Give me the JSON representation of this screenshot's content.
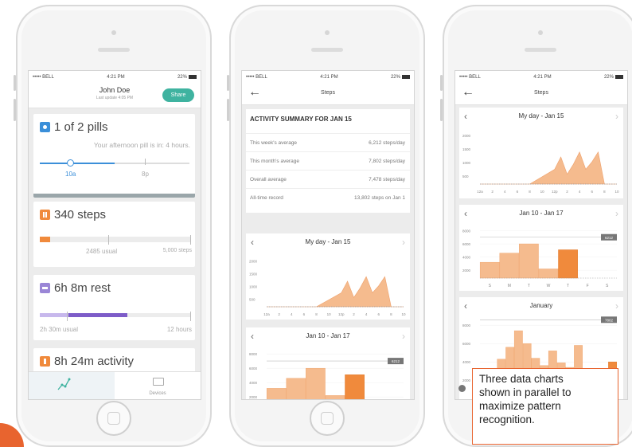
{
  "status_bar": {
    "carrier": "••••• BELL",
    "time": "4:21 PM",
    "battery": "22%"
  },
  "phone1": {
    "user_name": "John Doe",
    "last_update": "Last update 4:05 PM",
    "share_label": "Share",
    "pills": {
      "title": "1 of 2 pills",
      "subtitle": "Your afternoon pill is in: 4 hours.",
      "label_start": "10a",
      "label_end": "8p"
    },
    "steps": {
      "title": "340 steps",
      "usual": "2485 usual",
      "goal": "5,000 steps",
      "progress_fraction": 0.068
    },
    "rest": {
      "title": "6h 8m rest",
      "usual": "2h 30m usual",
      "goal": "12 hours"
    },
    "activity": {
      "title": "8h 24m activity"
    },
    "tabs": [
      {
        "label": ""
      },
      {
        "label": "Devices"
      }
    ]
  },
  "phone2": {
    "nav_title": "Steps",
    "summary_title": "ACTIVITY SUMMARY FOR JAN 15",
    "rows": [
      {
        "label": "This week's average",
        "value": "6,212 steps/day"
      },
      {
        "label": "This month's average",
        "value": "7,802 steps/day"
      },
      {
        "label": "Overall average",
        "value": "7,478 steps/day"
      },
      {
        "label": "All-time record",
        "value": "13,802 steps on Jan 1"
      }
    ]
  },
  "phone3": {
    "nav_title": "Steps"
  },
  "callout": {
    "text": "Three data charts\nshown in parallel to\nmaximize pattern\nrecognition."
  },
  "colors": {
    "accent": "#f08a3c",
    "area": "#f5bb8e",
    "share": "#3fb3a0",
    "pill": "#3b8fd9",
    "rest": "#7d5cc8",
    "callout_border": "#e8642f"
  },
  "chart_data": [
    {
      "type": "area",
      "title": "My day - Jan 15",
      "x": [
        "12a",
        "2",
        "4",
        "6",
        "8",
        "10",
        "12p",
        "2",
        "4",
        "6",
        "8",
        "10"
      ],
      "y_ticks": [
        "2000",
        "1500",
        "1000",
        "500"
      ],
      "ylim": [
        0,
        2200
      ],
      "points": [
        [
          0,
          0
        ],
        [
          1,
          0
        ],
        [
          2,
          0
        ],
        [
          3,
          0
        ],
        [
          4,
          0
        ],
        [
          5,
          300
        ],
        [
          6,
          600
        ],
        [
          6.5,
          1100
        ],
        [
          7,
          400
        ],
        [
          7.5,
          800
        ],
        [
          8,
          1300
        ],
        [
          8.5,
          600
        ],
        [
          9,
          900
        ],
        [
          9.5,
          1300
        ],
        [
          10,
          0
        ],
        [
          11,
          0
        ]
      ]
    },
    {
      "type": "bar",
      "title": "Jan 10 - Jan 17",
      "categories": [
        "S",
        "M",
        "T",
        "W",
        "T",
        "F",
        "S"
      ],
      "values": [
        2400,
        3800,
        5200,
        1400,
        4300,
        0,
        0
      ],
      "highlight_index": 4,
      "y_ticks": [
        "8000",
        "6000",
        "4000",
        "2000"
      ],
      "ylim": [
        0,
        8000
      ],
      "ref_label": "6212"
    },
    {
      "type": "bar",
      "title": "January",
      "values": [
        1200,
        2200,
        3500,
        4800,
        6600,
        5200,
        3600,
        2800,
        4400,
        3100,
        2600,
        5000,
        1800,
        2400,
        2000,
        3200
      ],
      "highlight_index": 15,
      "y_ticks": [
        "8000",
        "6000",
        "4000",
        "2000"
      ],
      "ylim": [
        0,
        8000
      ],
      "ref_label": "7802"
    }
  ]
}
